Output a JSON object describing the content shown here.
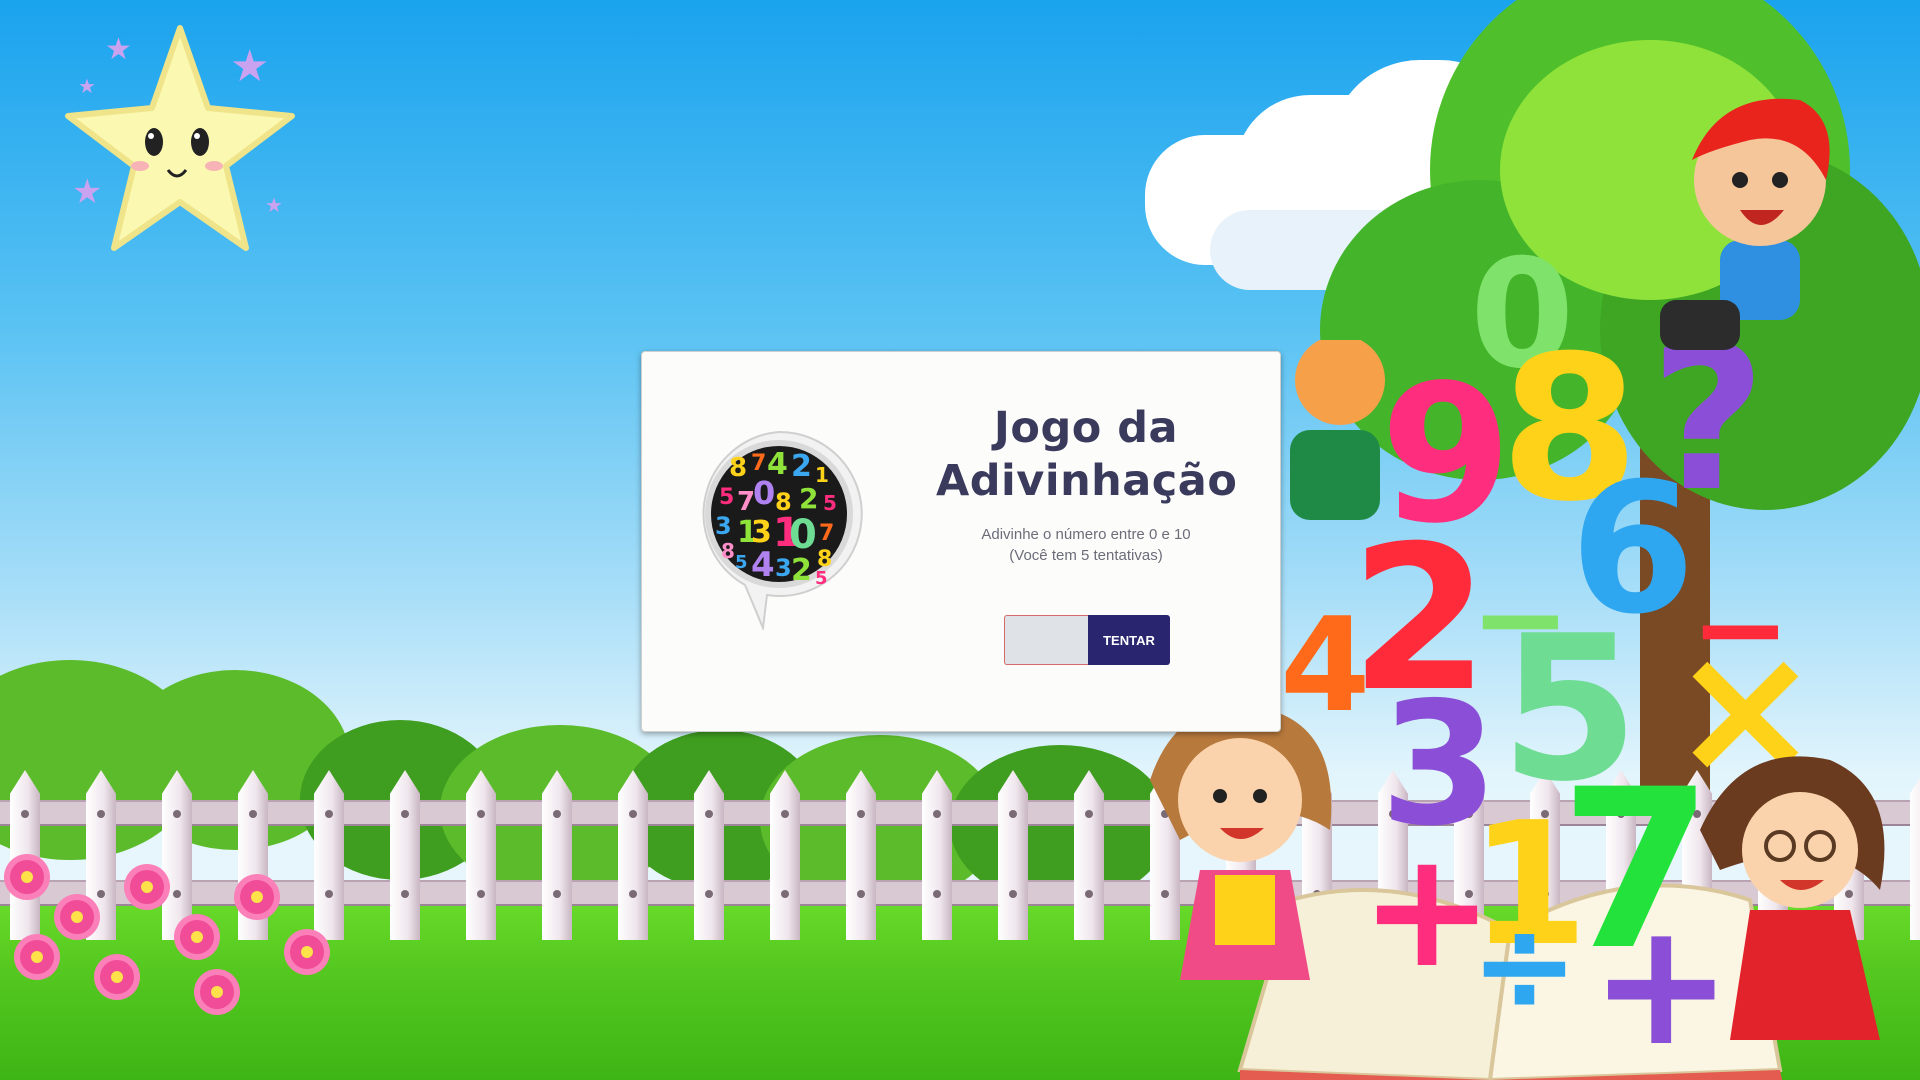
{
  "game": {
    "title_line1": "Jogo da",
    "title_line2": "Adivinhação",
    "instructions": "Adivinhe o número entre 0 e 10",
    "attempts_note": "(Você tem 5 tentativas)",
    "guess_value": "",
    "try_button_label": "TENTAR",
    "logo_icon": "numbers-speech-bubble-icon"
  },
  "colors": {
    "button_bg": "#29266f",
    "button_text": "#ffffff",
    "input_bg": "#dfe2e7",
    "input_border": "#d56a6a",
    "title_color": "#3a3a5c",
    "subtitle_color": "#6d6d7a"
  }
}
